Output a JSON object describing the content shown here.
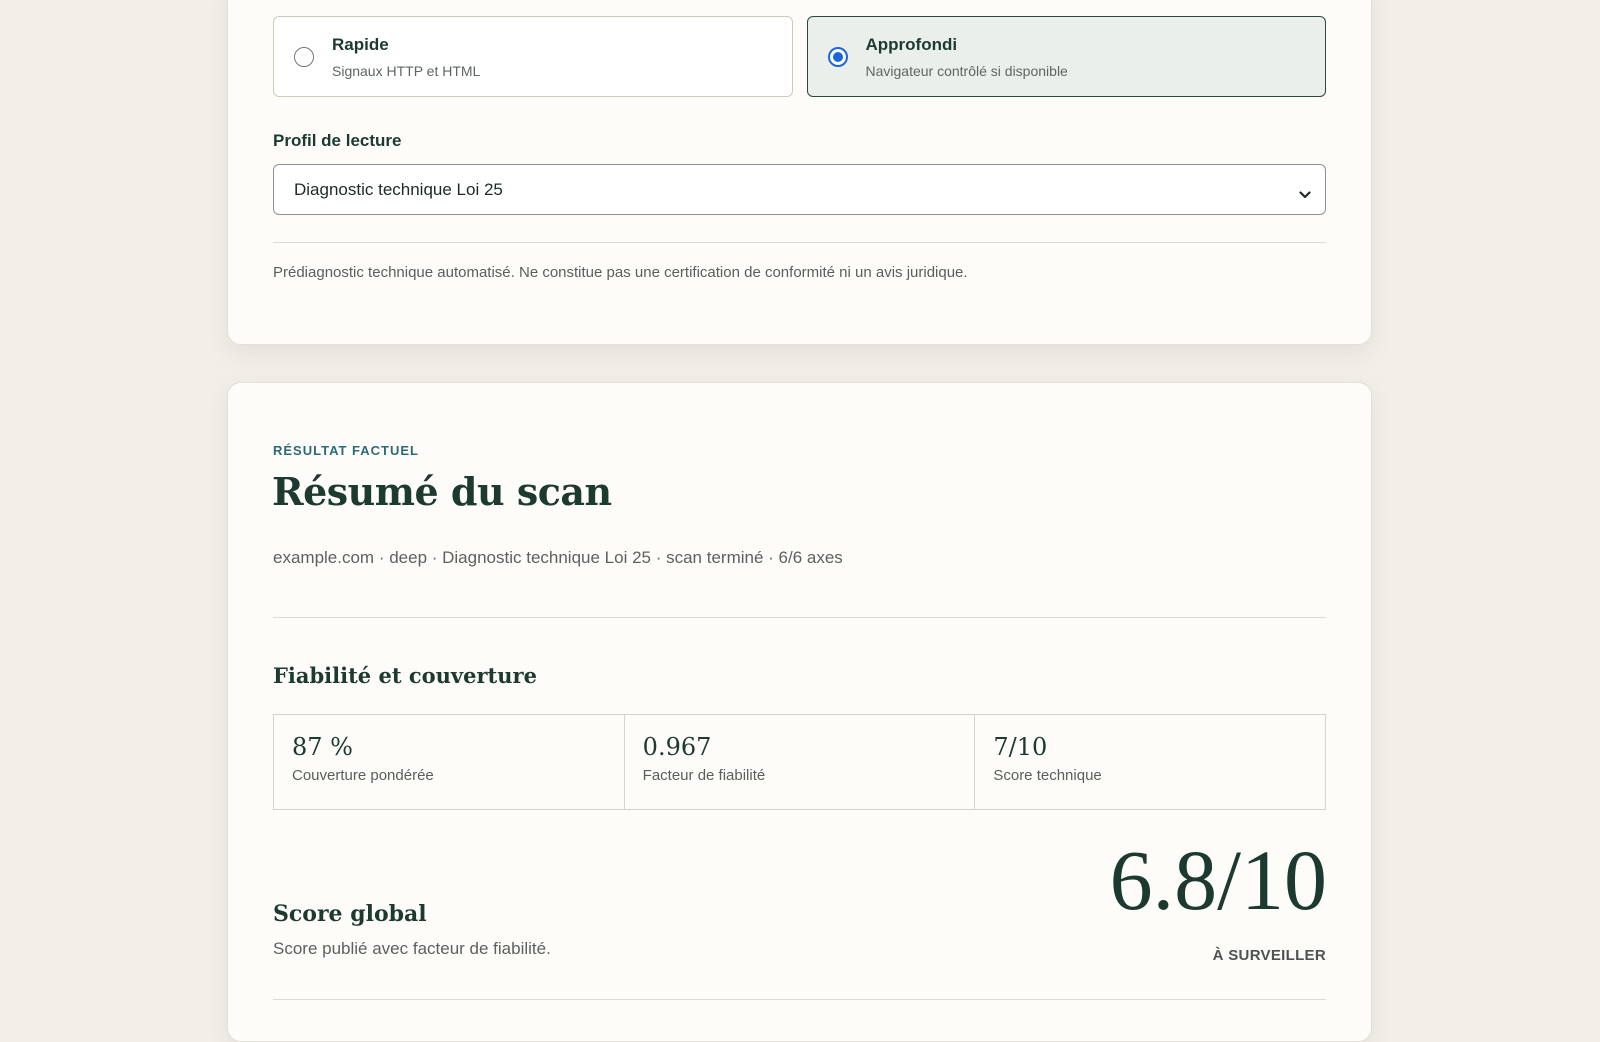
{
  "scan_settings": {
    "modes": [
      {
        "title": "Rapide",
        "subtitle": "Signaux HTTP et HTML",
        "selected": false
      },
      {
        "title": "Approfondi",
        "subtitle": "Navigateur contrôlé si disponible",
        "selected": true
      }
    ],
    "profile_label": "Profil de lecture",
    "profile_value": "Diagnostic technique Loi 25",
    "disclaimer": "Prédiagnostic technique automatisé. Ne constitue pas une certification de conformité ni un avis juridique."
  },
  "result": {
    "eyebrow": "RÉSULTAT FACTUEL",
    "title": "Résumé du scan",
    "meta": "example.com · deep · Diagnostic technique Loi 25 · scan terminé · 6/6 axes",
    "reliability": {
      "title": "Fiabilité et couverture",
      "metrics": [
        {
          "value": "87 %",
          "label": "Couverture pondérée"
        },
        {
          "value": "0.967",
          "label": "Facteur de fiabilité"
        },
        {
          "value": "7/10",
          "label": "Score technique"
        }
      ]
    },
    "score": {
      "title": "Score global",
      "subtitle": "Score publié avec facteur de fiabilité.",
      "value": "6.8/10",
      "status": "À SURVEILLER"
    }
  },
  "colors": {
    "background": "#f1efe8",
    "card": "#fdfcf8",
    "primary_text": "#1d3a30",
    "accent_eyebrow": "#2d6a78",
    "radio_checked": "#1a66e0",
    "selected_option_bg": "#ebefec"
  },
  "icons": {
    "select_chevron": "chevron-down-icon"
  }
}
